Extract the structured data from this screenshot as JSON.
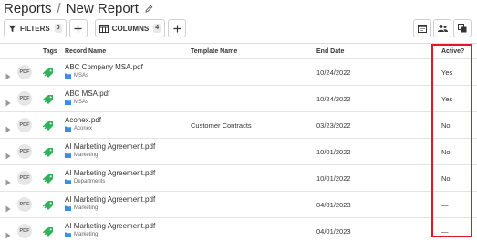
{
  "breadcrumb": {
    "parent": "Reports",
    "separator": "/",
    "current": "New Report"
  },
  "toolbar": {
    "filters_label": "FILTERS",
    "filters_count": "0",
    "columns_label": "COLUMNS",
    "columns_count": "4"
  },
  "table": {
    "headers": {
      "tags": "Tags",
      "record_name": "Record Name",
      "template_name": "Template Name",
      "end_date": "End Date",
      "active": "Active?"
    },
    "rows": [
      {
        "type": "PDF",
        "name": "ABC Company MSA.pdf",
        "folder": "MSAs",
        "template": "",
        "end_date": "10/24/2022",
        "active": "Yes"
      },
      {
        "type": "PDF",
        "name": "ABC MSA.pdf",
        "folder": "MSAs",
        "template": "",
        "end_date": "10/24/2022",
        "active": "Yes"
      },
      {
        "type": "PDF",
        "name": "Aconex.pdf",
        "folder": "Aconex",
        "template": "Customer Contracts",
        "end_date": "03/23/2022",
        "active": "No"
      },
      {
        "type": "PDF",
        "name": "AI Marketing Agreement.pdf",
        "folder": "Marketing",
        "template": "",
        "end_date": "10/01/2022",
        "active": "No"
      },
      {
        "type": "PDF",
        "name": "AI Marketing Agreement.pdf",
        "folder": "Departments",
        "template": "",
        "end_date": "10/01/2022",
        "active": "No"
      },
      {
        "type": "PDF",
        "name": "AI Marketing Agreement.pdf",
        "folder": "Marketing",
        "template": "",
        "end_date": "04/01/2023",
        "active": "—"
      },
      {
        "type": "PDF",
        "name": "AI Marketing Agreement.pdf",
        "folder": "Marketing",
        "template": "",
        "end_date": "04/01/2023",
        "active": "—"
      }
    ]
  },
  "colors": {
    "tag_green": "#2fb35a",
    "folder_blue": "#3a8ee6",
    "highlight_red": "#e0162b"
  }
}
